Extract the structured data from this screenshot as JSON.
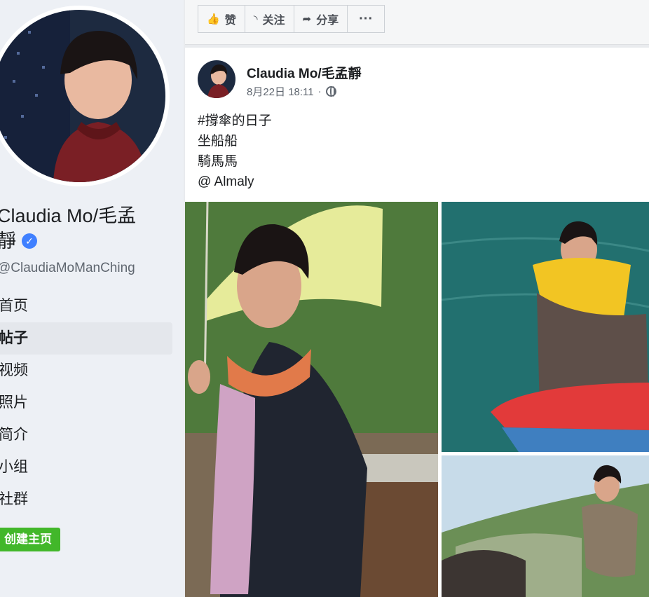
{
  "sidebar": {
    "name_line1": "Claudia Mo/毛孟",
    "name_line2": "靜",
    "verified_icon": "check-icon",
    "handle": "@ClaudiaMoManChing",
    "nav": [
      {
        "label": "首页",
        "active": false
      },
      {
        "label": "帖子",
        "active": true
      },
      {
        "label": "视频",
        "active": false
      },
      {
        "label": "照片",
        "active": false
      },
      {
        "label": "简介",
        "active": false
      },
      {
        "label": "小组",
        "active": false
      },
      {
        "label": "社群",
        "active": false
      }
    ],
    "create_page_label": "创建主页"
  },
  "actions": {
    "like": {
      "label": "赞",
      "icon": "thumbs-up-icon"
    },
    "follow": {
      "label": "关注",
      "icon": "rss-icon"
    },
    "share": {
      "label": "分享",
      "icon": "share-arrow-icon"
    },
    "more": {
      "label": "···",
      "icon": "more-icon"
    }
  },
  "post": {
    "author": "Claudia Mo/毛孟靜",
    "date": "8月22日 18:11",
    "separator": "·",
    "privacy_icon": "globe-icon",
    "lines": [
      "#撐傘的日子",
      "坐船船",
      "騎馬馬",
      "@ Almaly"
    ]
  },
  "colors": {
    "verified": "#4080ff",
    "create_button": "#42b72a",
    "link_text": "#1c1e21"
  }
}
